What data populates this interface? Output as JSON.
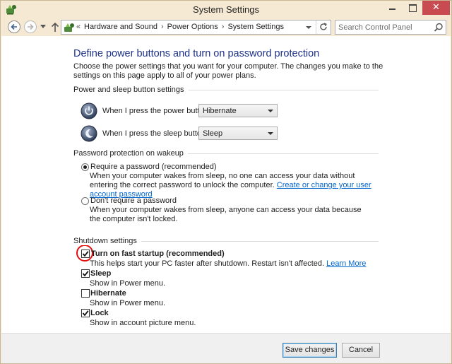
{
  "window": {
    "title": "System Settings",
    "controls": {
      "close_glyph": "✕"
    },
    "accent_close": "#c74b50"
  },
  "address": {
    "overflow": "«",
    "breadcrumbs": [
      "Hardware and Sound",
      "Power Options",
      "System Settings"
    ],
    "separator": "›",
    "search_placeholder": "Search Control Panel"
  },
  "page": {
    "title": "Define power buttons and turn on password protection",
    "description": "Choose the power settings that you want for your computer. The changes you make to the settings on this page apply to all of your power plans."
  },
  "power_buttons": {
    "group_label": "Power and sleep button settings",
    "power_label": "When I press the power button:",
    "power_value": "Hibernate",
    "sleep_label": "When I press the sleep button:",
    "sleep_value": "Sleep"
  },
  "password": {
    "group_label": "Password protection on wakeup",
    "require_label": "Require a password (recommended)",
    "require_desc": "When your computer wakes from sleep, no one can access your data without entering the correct password to unlock the computer.",
    "require_link": "Create or change your user account password",
    "require_checked": true,
    "dont_label": "Don't require a password",
    "dont_desc": "When your computer wakes from sleep, anyone can access your data because the computer isn't locked.",
    "dont_checked": false
  },
  "shutdown": {
    "group_label": "Shutdown settings",
    "items": [
      {
        "label": "Turn on fast startup (recommended)",
        "desc": "This helps start your PC faster after shutdown. Restart isn't affected.",
        "link": "Learn More",
        "checked": true
      },
      {
        "label": "Sleep",
        "desc": "Show in Power menu.",
        "checked": true
      },
      {
        "label": "Hibernate",
        "desc": "Show in Power menu.",
        "checked": false
      },
      {
        "label": "Lock",
        "desc": "Show in account picture menu.",
        "checked": true
      }
    ],
    "annotation_color": "#e01010"
  },
  "footer": {
    "save_label": "Save changes",
    "cancel_label": "Cancel"
  },
  "colors": {
    "title_blue": "#1e3287",
    "link_blue": "#0066cc",
    "chrome": "#f5e9d3"
  }
}
